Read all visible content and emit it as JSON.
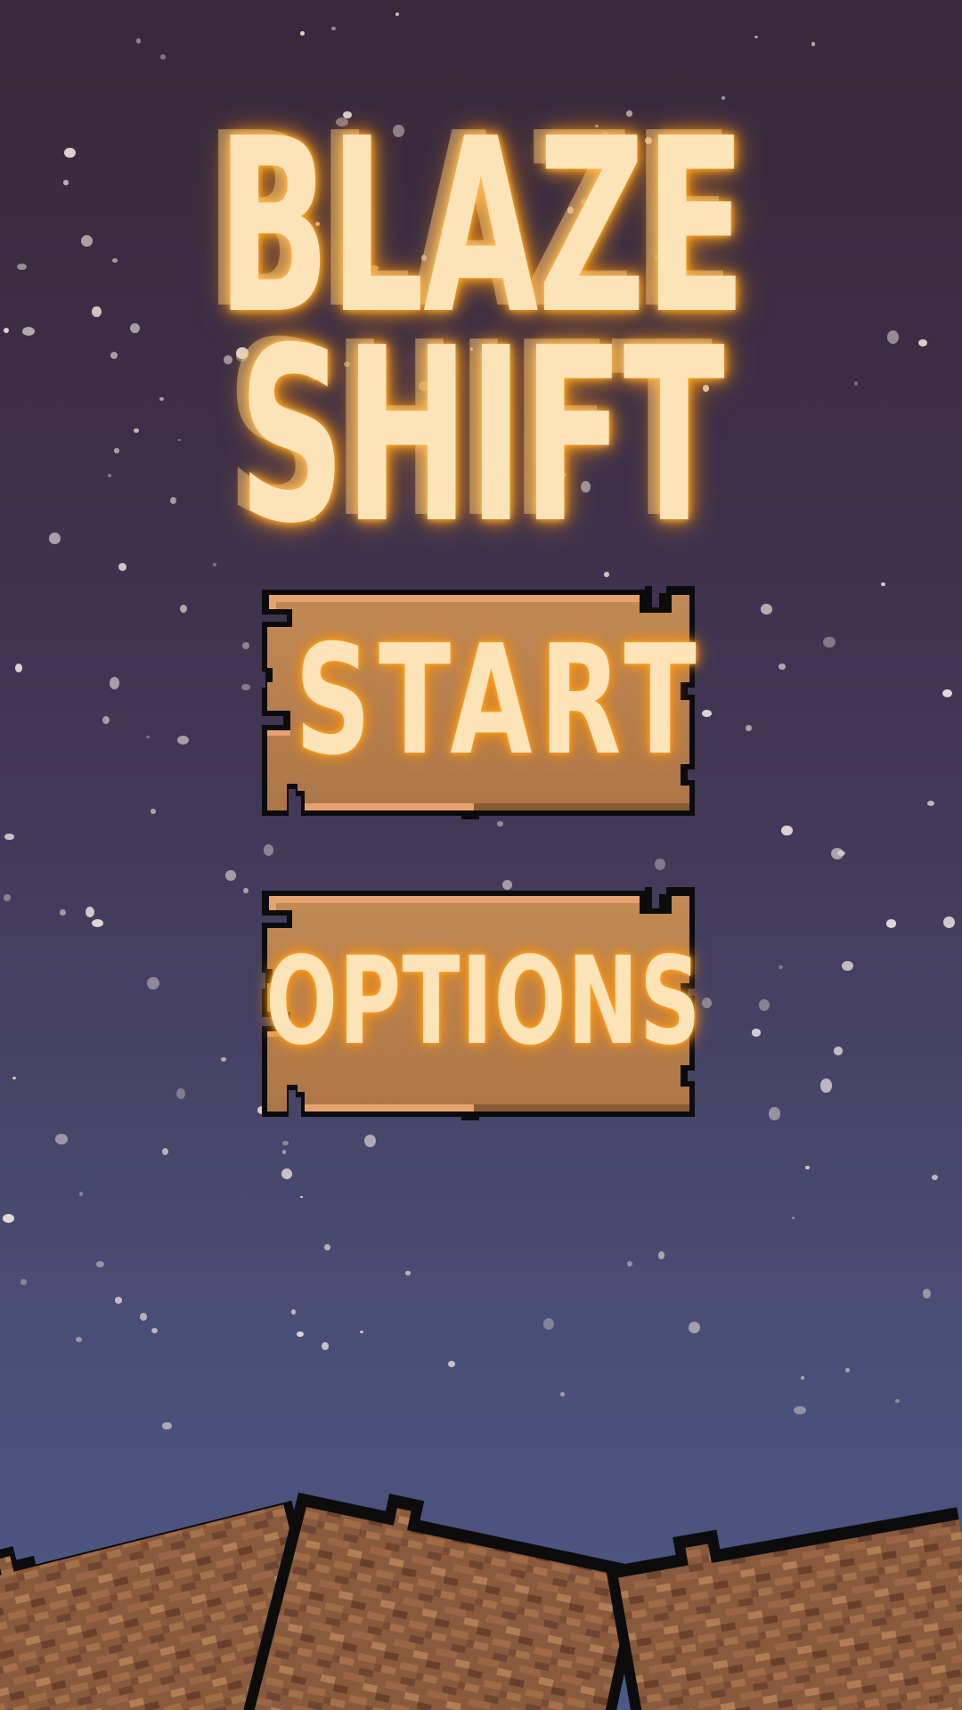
{
  "game": {
    "title_line1": "BLAZE",
    "title_line2": "SHIFT"
  },
  "menu": {
    "start_label": "START",
    "options_label": "OPTIONS"
  },
  "colors": {
    "sky_top": "#38293a",
    "sky_bottom": "#4d5888",
    "title_fill": "#fde3b8",
    "title_glow": "#ff9d12",
    "wood": "#b98350",
    "wood_highlight": "#e7a36f",
    "outline": "#0c0c0c",
    "dirt": "#8a5a3c"
  },
  "icons": {
    "background": "falling-snow-icon",
    "ground": "dirt-block-icon"
  }
}
